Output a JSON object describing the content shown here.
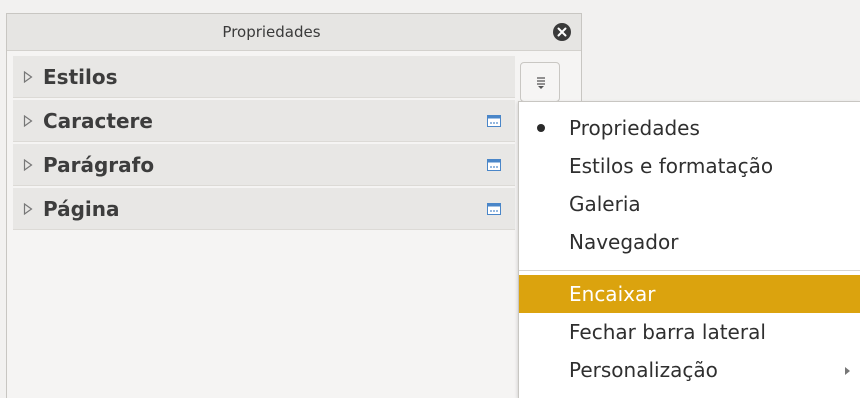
{
  "panel": {
    "title": "Propriedades",
    "close_icon": "close-icon",
    "decks": [
      {
        "label": "Estilos",
        "has_more": false
      },
      {
        "label": "Caractere",
        "has_more": true
      },
      {
        "label": "Parágrafo",
        "has_more": true
      },
      {
        "label": "Página",
        "has_more": true
      }
    ]
  },
  "menu_button_icon": "menu-icon",
  "menu": {
    "items": [
      {
        "label": "Propriedades",
        "selected": true
      },
      {
        "label": "Estilos e formatação"
      },
      {
        "label": "Galeria"
      },
      {
        "label": "Navegador"
      },
      {
        "label": "Encaixar",
        "highlighted": true
      },
      {
        "label": "Fechar barra lateral"
      },
      {
        "label": "Personalização",
        "submenu": true
      }
    ]
  },
  "colors": {
    "highlight": "#dba30e",
    "panel_background": "#f5f4f3"
  }
}
